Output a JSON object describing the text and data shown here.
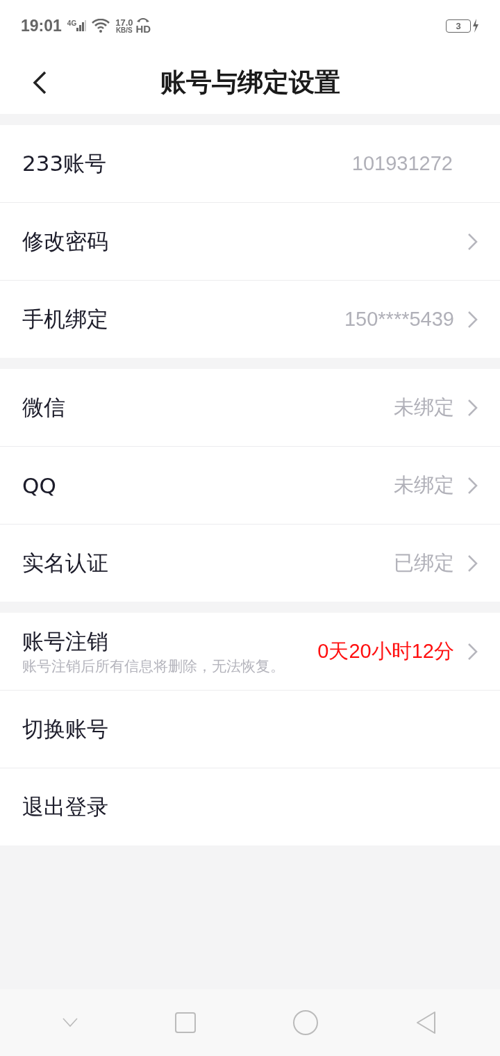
{
  "status_bar": {
    "time": "19:01",
    "network": "4G",
    "speed": "17.0",
    "speed_unit": "KB/S",
    "hd": "HD",
    "battery": "3",
    "charging": true
  },
  "header": {
    "title": "账号与绑定设置"
  },
  "groups": [
    {
      "rows": [
        {
          "label": "233账号",
          "value": "101931272",
          "alert": false,
          "arrow": false
        },
        {
          "label": "修改密码",
          "arrow": true
        },
        {
          "label": "手机绑定",
          "value": "150****5439",
          "alert": false,
          "arrow": true
        }
      ]
    },
    {
      "rows": [
        {
          "label": "微信",
          "value": "未绑定",
          "alert": false,
          "arrow": true
        },
        {
          "label": "QQ",
          "value": "未绑定",
          "alert": false,
          "arrow": true
        },
        {
          "label": "实名认证",
          "value": "已绑定",
          "alert": false,
          "arrow": true
        }
      ]
    },
    {
      "rows": [
        {
          "label": "账号注销",
          "sublabel": "账号注销后所有信息将删除，无法恢复。",
          "value": "0天20小时12分",
          "alert": true,
          "arrow": true
        },
        {
          "label": "切换账号",
          "arrow": false
        },
        {
          "label": "退出登录",
          "arrow": false
        }
      ]
    }
  ]
}
